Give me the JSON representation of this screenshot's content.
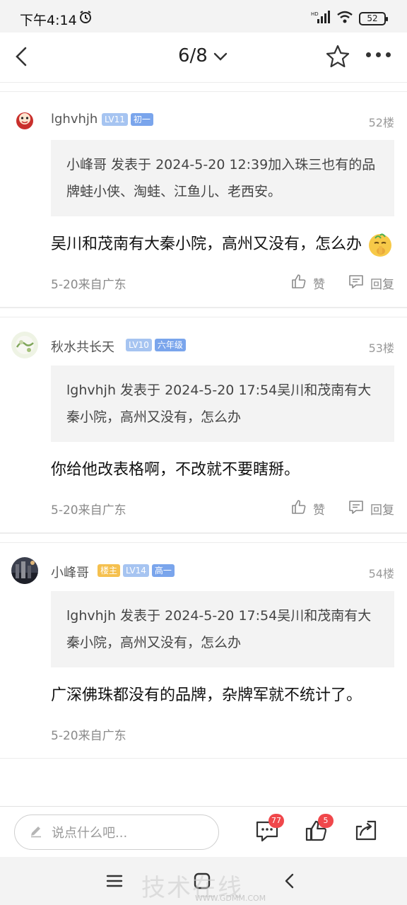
{
  "status_bar": {
    "time": "下午4:14",
    "battery": "52"
  },
  "nav": {
    "page_indicator": "6/8"
  },
  "posts": [
    {
      "username": "lghvhjh",
      "badges": [
        "LV11",
        "初一"
      ],
      "floor": "52楼",
      "quote": "小峰哥 发表于 2024-5-20 12:39加入珠三也有的品牌蛙小侠、淘蛙、江鱼儿、老西安。",
      "body": "吴川和茂南有大秦小院，高州又没有，怎么办",
      "meta": "5-20来自广东",
      "like_label": "赞",
      "reply_label": "回复"
    },
    {
      "username": "秋水共长天",
      "badges": [
        "LV10",
        "六年级"
      ],
      "floor": "53楼",
      "quote": "lghvhjh 发表于 2024-5-20 17:54吴川和茂南有大秦小院，高州又没有，怎么办",
      "body": "你给他改表格啊，不改就不要瞎掰。",
      "meta": "5-20来自广东",
      "like_label": "赞",
      "reply_label": "回复"
    },
    {
      "username": "小峰哥",
      "badges": [
        "楼主",
        "LV14",
        "高一"
      ],
      "floor": "54楼",
      "quote": "lghvhjh 发表于 2024-5-20 17:54吴川和茂南有大秦小院，高州又没有，怎么办",
      "body": "广深佛珠都没有的品牌，杂牌军就不统计了。",
      "meta": "5-20来自广东"
    }
  ],
  "bottom_bar": {
    "input_placeholder": "说点什么吧...",
    "comment_count": "77",
    "like_count": "5"
  },
  "watermark": {
    "text": "技术在线",
    "url": "WWW.GDMM.COM"
  },
  "colors": {
    "lv_badge": "#a6c4f1",
    "grade_badge": "#7aa5ec",
    "owner_badge": "#f5c04e",
    "count_badge": "#f0474b"
  }
}
